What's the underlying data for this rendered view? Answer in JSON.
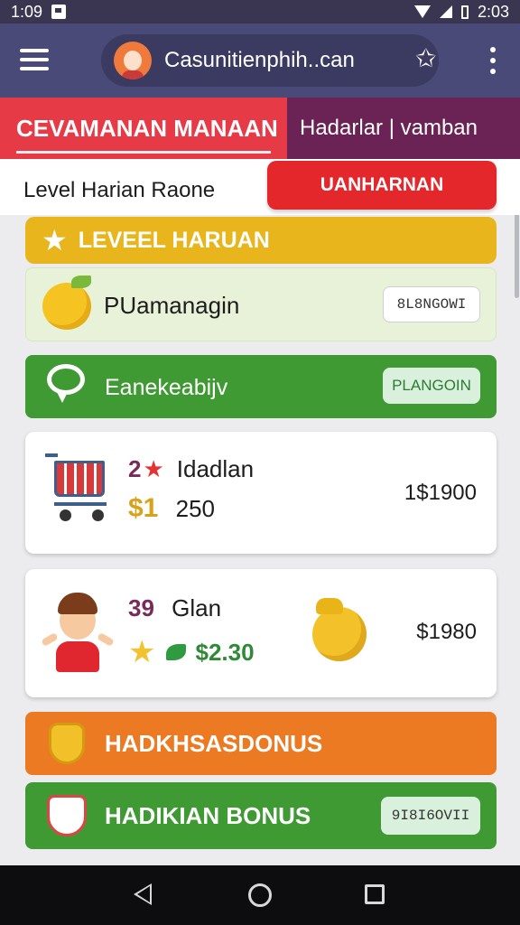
{
  "status": {
    "time": "1:09",
    "time_right": "2:03"
  },
  "appbar": {
    "search_text": "Casunitienphih..can"
  },
  "tabs": [
    {
      "label": "CEVAMANAN MANAAN"
    },
    {
      "label": "Hadarlar | vamban"
    }
  ],
  "header": {
    "title": "Level Harian Raone",
    "button_label": "UANHARNAN"
  },
  "level_banner": {
    "label": "LEVEEL HARUAN"
  },
  "row1": {
    "label": "PUamanagin",
    "button_label": "8L8NGOWI"
  },
  "row2": {
    "label": "Eanekeabijv",
    "button_label": "PLANGOIN"
  },
  "card1": {
    "count": "2",
    "name": "Idadlan",
    "dollar": "$1",
    "value": "250",
    "price": "1$1900"
  },
  "card2": {
    "count": "39",
    "name": "Glan",
    "amount": "$2.30",
    "price": "$1980"
  },
  "bonus1": {
    "label": "HADKHSASDONUS"
  },
  "bonus2": {
    "label": "HADIKIAN BONUS",
    "button_label": "9I8I6OVII"
  },
  "colors": {
    "appbar": "#4a4a78",
    "tab_active": "#e63a46",
    "tab_inactive": "#6b2356",
    "accent_yellow": "#e8b51c",
    "accent_green": "#3f9a33",
    "accent_orange": "#ec7a23",
    "button_red": "#e4272b"
  }
}
